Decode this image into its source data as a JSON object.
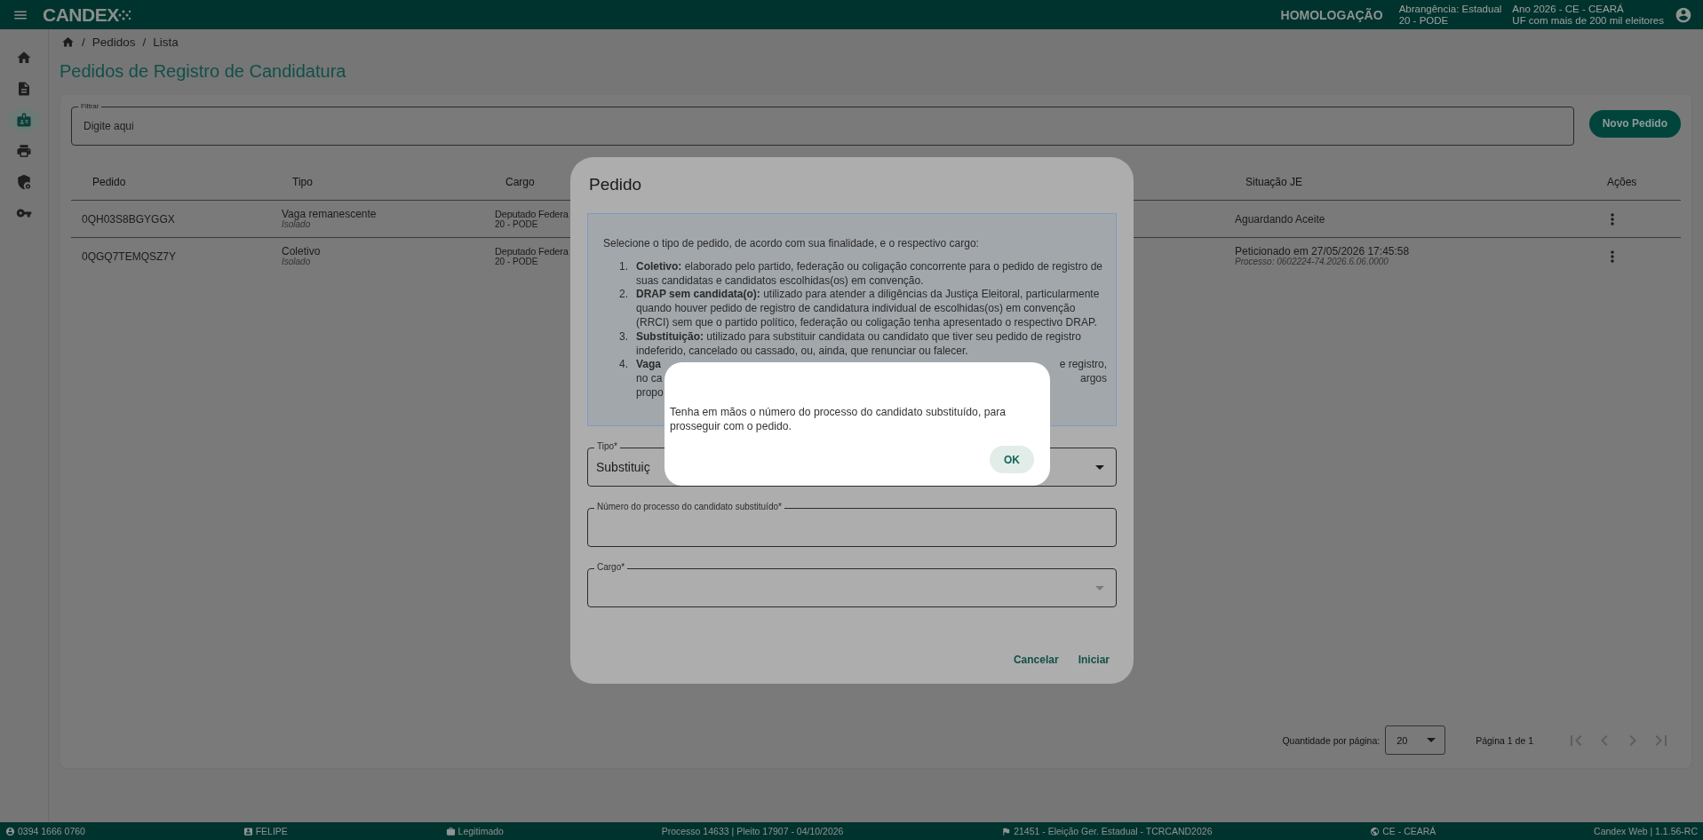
{
  "topbar": {
    "logo": "CANDEX",
    "environment": "HOMOLOGAÇÃO",
    "scope": [
      "Abrangência: Estadual",
      "20 - PODE"
    ],
    "election": [
      "Ano 2026 - CE - CEARÁ",
      "UF com mais de 200 mil eleitores"
    ]
  },
  "sidebar": {
    "items": [
      {
        "kind": "home",
        "selected": false
      },
      {
        "kind": "document",
        "selected": false
      },
      {
        "kind": "badge",
        "selected": true
      },
      {
        "kind": "printer",
        "selected": false
      },
      {
        "kind": "shield",
        "selected": false
      },
      {
        "kind": "key",
        "selected": false
      }
    ]
  },
  "breadcrumb": {
    "items": [
      {
        "separator": "/",
        "label": "Pedidos"
      },
      {
        "separator": "/",
        "label": "Lista"
      }
    ]
  },
  "page_title": "Pedidos de Registro de Candidatura",
  "filter": {
    "label": "Filtrar",
    "placeholder": "Digite aqui"
  },
  "new_button": "Novo Pedido",
  "table": {
    "columns": [
      "Pedido",
      "Tipo",
      "Cargo",
      "Situação JE",
      "Ações"
    ],
    "rows": [
      {
        "pedido": "0QH03S8BGYGGX",
        "tipo": "Vaga remanescente",
        "tipo_detail": "Isolado",
        "cargo": "Deputado Federa",
        "cargo_detail": "20 - PODE",
        "situacao": "Aguardando Aceite"
      },
      {
        "pedido": "0QGQ7TEMQSZ7Y",
        "tipo": "Coletivo",
        "tipo_detail": "Isolado",
        "cargo": "Deputado Federa",
        "cargo_detail": "20 - PODE",
        "situacao": "Peticionado em 27/05/2026 17:45:58",
        "situacao_detail": "Processo: 0602224-74.2026.6.06.0000"
      }
    ]
  },
  "pagination": {
    "per_page_label": "Quantidade por página:",
    "per_page": "20",
    "page_info": "Página 1 de 1"
  },
  "dialog": {
    "title": "Pedido",
    "intro": "Selecione o tipo de pedido, de acordo com sua finalidade, e o respectivo cargo:",
    "items": [
      {
        "number": "1.",
        "term": "Coletivo:",
        "text": "elaborado pelo partido, federação ou coligação concorrente para o pedido de registro de suas candidatas e candidatos escolhidas(os) em convenção."
      },
      {
        "number": "2.",
        "term": "DRAP sem candidata(o):",
        "text": "utilizado para atender a diligências da Justiça Eleitoral, particularmente quando houver pedido de registro de candidatura individual de escolhidas(os) em convenção (RRCI) sem que o partido político, federação ou coligação tenha apresentado o respectivo DRAP."
      },
      {
        "number": "3.",
        "term": "Substituição:",
        "text": "utilizado para substituir candidata ou candidato que tiver seu pedido de registro indeferido, cancelado ou cassado, ou, ainda, que renunciar ou falecer."
      },
      {
        "number": "4.",
        "term": "Vaga",
        "lines": [
          {
            "right": "e registro,"
          },
          {
            "left": "no ca",
            "right": "argos"
          },
          {
            "left": "propo"
          }
        ]
      }
    ],
    "fields": [
      {
        "kind": "select",
        "label": "Tipo*",
        "value": "Substituiç",
        "disabled": false
      },
      {
        "kind": "text",
        "label": "Número do processo do candidato substituído*"
      },
      {
        "kind": "select",
        "label": "Cargo*",
        "disabled": true
      }
    ],
    "buttons": [
      "Cancelar",
      "Iniciar"
    ]
  },
  "alert": {
    "message": "Tenha em mãos o número do processo do candidato substituído, para prosseguir com o pedido.",
    "button": "OK"
  },
  "status_bar": [
    {
      "kind": "person",
      "text": "0394 1666 0760"
    },
    {
      "kind": "idcard",
      "text": "FELIPE"
    },
    {
      "kind": "briefcase",
      "text": "Legitimado"
    },
    {
      "text": "Processo 14633 | Pleito 17907 - 04/10/2026"
    },
    {
      "kind": "flag",
      "text": "21451 - Eleição Ger. Estadual - TCRCAND2026"
    },
    {
      "kind": "globe",
      "text": "CE - CEARÁ"
    },
    {
      "text": "Candex Web | 1.1.56-RC"
    }
  ]
}
